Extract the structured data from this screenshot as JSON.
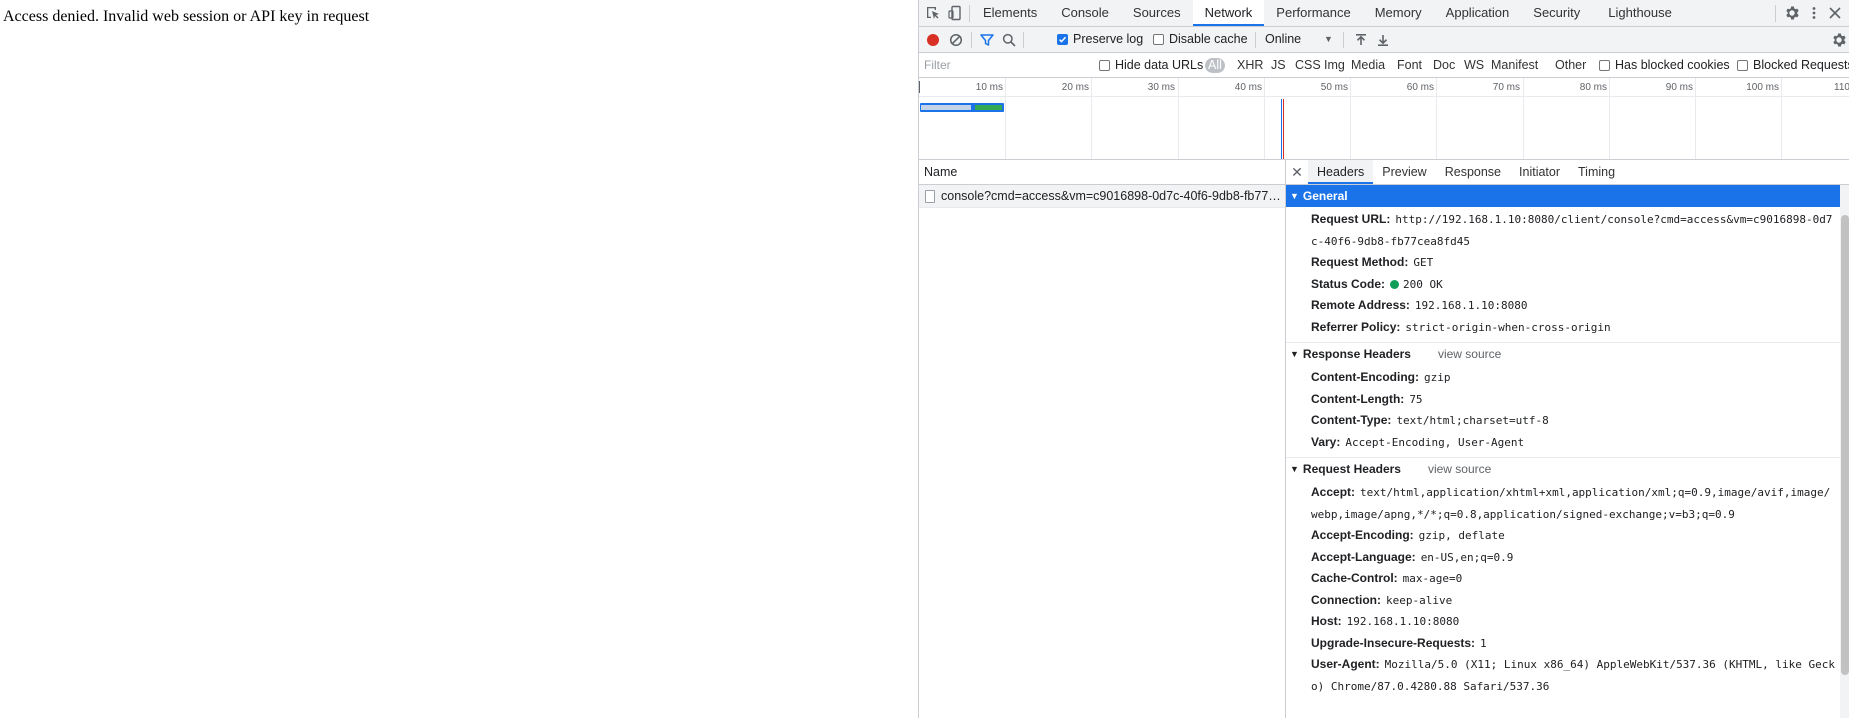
{
  "page": {
    "message": "Access denied. Invalid web session or API key in request"
  },
  "devtools": {
    "tabs": [
      "Elements",
      "Console",
      "Sources",
      "Network",
      "Performance",
      "Memory",
      "Application",
      "Security",
      "Lighthouse"
    ],
    "active_tab": "Network",
    "toolbar": {
      "preserve_log": "Preserve log",
      "preserve_log_checked": true,
      "disable_cache": "Disable cache",
      "disable_cache_checked": false,
      "throttle": "Online"
    },
    "filter": {
      "placeholder": "Filter",
      "hide_data_urls": "Hide data URLs",
      "types": [
        "All",
        "XHR",
        "JS",
        "CSS",
        "Img",
        "Media",
        "Font",
        "Doc",
        "WS",
        "Manifest",
        "Other"
      ],
      "has_blocked_cookies": "Has blocked cookies",
      "blocked_requests": "Blocked Requests"
    },
    "overview": {
      "ticks": [
        "10 ms",
        "20 ms",
        "30 ms",
        "40 ms",
        "50 ms",
        "60 ms",
        "70 ms",
        "80 ms",
        "90 ms",
        "100 ms",
        "110"
      ]
    },
    "requests": {
      "column_name": "Name",
      "rows": [
        "console?cmd=access&vm=c9016898-0d7c-40f6-9db8-fb77cea8fd45"
      ]
    },
    "detail": {
      "tabs": [
        "Headers",
        "Preview",
        "Response",
        "Initiator",
        "Timing"
      ],
      "active_tab": "Headers",
      "view_source": "view source",
      "general": {
        "title": "General",
        "rows": [
          {
            "k": "Request URL:",
            "v": "http://192.168.1.10:8080/client/console?cmd=access&vm=c9016898-0d7c-40f6-9db8-fb77cea8fd45"
          },
          {
            "k": "Request Method:",
            "v": "GET"
          },
          {
            "k": "Status Code:",
            "v": "200 OK"
          },
          {
            "k": "Remote Address:",
            "v": "192.168.1.10:8080"
          },
          {
            "k": "Referrer Policy:",
            "v": "strict-origin-when-cross-origin"
          }
        ]
      },
      "response_headers": {
        "title": "Response Headers",
        "rows": [
          {
            "k": "Content-Encoding:",
            "v": "gzip"
          },
          {
            "k": "Content-Length:",
            "v": "75"
          },
          {
            "k": "Content-Type:",
            "v": "text/html;charset=utf-8"
          },
          {
            "k": "Vary:",
            "v": "Accept-Encoding, User-Agent"
          }
        ]
      },
      "request_headers": {
        "title": "Request Headers",
        "rows": [
          {
            "k": "Accept:",
            "v": "text/html,application/xhtml+xml,application/xml;q=0.9,image/avif,image/webp,image/apng,*/*;q=0.8,application/signed-exchange;v=b3;q=0.9"
          },
          {
            "k": "Accept-Encoding:",
            "v": "gzip, deflate"
          },
          {
            "k": "Accept-Language:",
            "v": "en-US,en;q=0.9"
          },
          {
            "k": "Cache-Control:",
            "v": "max-age=0"
          },
          {
            "k": "Connection:",
            "v": "keep-alive"
          },
          {
            "k": "Host:",
            "v": "192.168.1.10:8080"
          },
          {
            "k": "Upgrade-Insecure-Requests:",
            "v": "1"
          },
          {
            "k": "User-Agent:",
            "v": "Mozilla/5.0 (X11; Linux x86_64) AppleWebKit/537.36 (KHTML, like Gecko) Chrome/87.0.4280.88 Safari/537.36"
          }
        ]
      }
    }
  },
  "icons": {
    "inspect": "inspect-element-icon",
    "device": "device-toolbar-icon",
    "settings": "gear-icon",
    "more": "kebab-menu-icon",
    "close": "close-icon",
    "record": "record-icon",
    "clear": "clear-icon",
    "filter": "filter-icon",
    "search": "search-icon",
    "import": "import-har-icon",
    "export": "export-har-icon"
  },
  "colors": {
    "accent": "#1a73e8",
    "record": "#d93025",
    "status_ok": "#0f9d58",
    "toolbar_bg": "#f1f3f4"
  }
}
